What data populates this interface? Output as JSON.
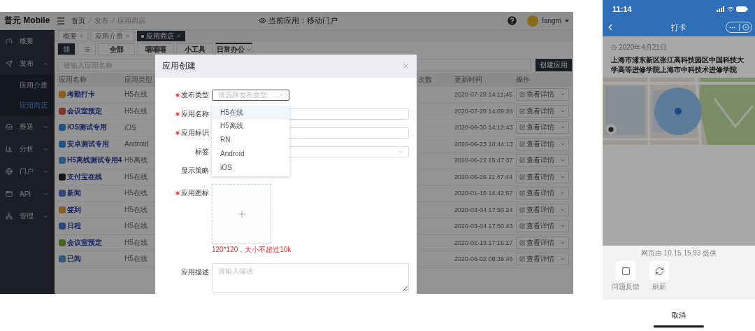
{
  "header": {
    "logo": "普元 Mobile",
    "breadcrumb": [
      "首页",
      "发布",
      "应用商店"
    ],
    "current_app": "当前应用：移动门户",
    "user": "fangm"
  },
  "sidebar": {
    "items": [
      {
        "label": "概要",
        "selected": false
      },
      {
        "label": "发布",
        "selected": false,
        "expanded": true,
        "children": [
          {
            "label": "应用介质",
            "selected": false
          },
          {
            "label": "应用商店",
            "selected": true
          }
        ]
      },
      {
        "label": "推送",
        "selected": false,
        "expanded": false
      },
      {
        "label": "分析",
        "selected": false,
        "expanded": false
      },
      {
        "label": "门户",
        "selected": false,
        "expanded": false
      },
      {
        "label": "API",
        "selected": false,
        "expanded": false
      },
      {
        "label": "管理",
        "selected": false,
        "expanded": false
      }
    ]
  },
  "tags": [
    {
      "label": "概要",
      "selected": false
    },
    {
      "label": "应用介质",
      "selected": false
    },
    {
      "label": "应用商店",
      "selected": true
    }
  ],
  "view_toggle": [
    {
      "selected": true
    },
    {
      "selected": false
    }
  ],
  "categories": [
    {
      "label": "全部",
      "selected": false
    },
    {
      "label": "嘻嘻嘻",
      "selected": false
    },
    {
      "label": "小工具",
      "selected": false
    },
    {
      "label": "日常办公",
      "selected": true
    }
  ],
  "search": {
    "placeholder": "请输入应用名称"
  },
  "create_button": "创建应用",
  "table": {
    "columns": [
      "应用名称",
      "应用类型",
      "次数",
      "更新时间",
      "操作"
    ],
    "rows": [
      {
        "name": "考勤打卡",
        "type": "H5在线",
        "updated": "2020-07-28 14:11:45",
        "action": "查看详情"
      },
      {
        "name": "会议室预定",
        "type": "H5在线",
        "updated": "2020-07-28 14:09:28",
        "action": "查看详情"
      },
      {
        "name": "iOS测试专用",
        "type": "iOS",
        "updated": "2020-06-30 14:12:43",
        "action": "查看详情"
      },
      {
        "name": "安卓测试专用",
        "type": "Android",
        "updated": "2020-06-23 10:44:13",
        "action": "查看详情"
      },
      {
        "name": "H5离线测试专用4",
        "type": "H5离线",
        "updated": "2020-06-22 15:47:37",
        "action": "查看详情"
      },
      {
        "name": "支付宝在线",
        "type": "H5在线",
        "updated": "2020-05-26 11:47:44",
        "action": "查看详情"
      },
      {
        "name": "新闻",
        "type": "H5在线",
        "updated": "2020-01-15 14:42:57",
        "action": "查看详情"
      },
      {
        "name": "签到",
        "type": "H5在线",
        "updated": "2020-03-04 17:50:24",
        "action": "查看详情"
      },
      {
        "name": "日程",
        "type": "H5在线",
        "updated": "2020-03-04 17:50:43",
        "action": "查看详情"
      },
      {
        "name": "会议室预定",
        "type": "H5在线",
        "updated": "2020-02-19 17:16:17",
        "action": "查看详情"
      },
      {
        "name": "已阅",
        "type": "H5在线",
        "updated": "2020-06-02 08:39:46",
        "action": "查看详情"
      }
    ]
  },
  "modal": {
    "title": "应用创建",
    "fields": [
      {
        "kind": "select",
        "label": "发布类型",
        "required": true,
        "placeholder": "请选择发布类型",
        "open": true,
        "options": [
          {
            "label": "H5在线",
            "selected": true
          },
          {
            "label": "H5离线",
            "selected": false
          },
          {
            "label": "RN",
            "selected": false
          },
          {
            "label": "Android",
            "selected": false
          },
          {
            "label": "iOS",
            "selected": false
          }
        ]
      },
      {
        "kind": "input",
        "label": "应用名称",
        "required": true
      },
      {
        "kind": "input",
        "label": "应用标识",
        "required": true
      },
      {
        "kind": "select",
        "label": "标签",
        "required": false,
        "open": false
      },
      {
        "kind": "blank",
        "label": "显示策略",
        "required": false
      },
      {
        "kind": "upload",
        "label": "应用图标",
        "required": true,
        "hint": "120*120，大小不超过10k"
      },
      {
        "kind": "textarea",
        "label": "应用描述",
        "required": false,
        "placeholder": "请输入描述"
      }
    ]
  },
  "phone": {
    "time": "11:14",
    "title": "打卡",
    "date": "2020年4月21日",
    "address": "上海市浦东新区张江高科技园区中国科技大学高等进修学院上海市中科技术进修学院",
    "sheet": {
      "provider": "网页由 10.15.15.93 提供",
      "actions": [
        {
          "label": "问题反馈"
        },
        {
          "label": "刷新"
        }
      ],
      "cancel": "取消"
    }
  }
}
